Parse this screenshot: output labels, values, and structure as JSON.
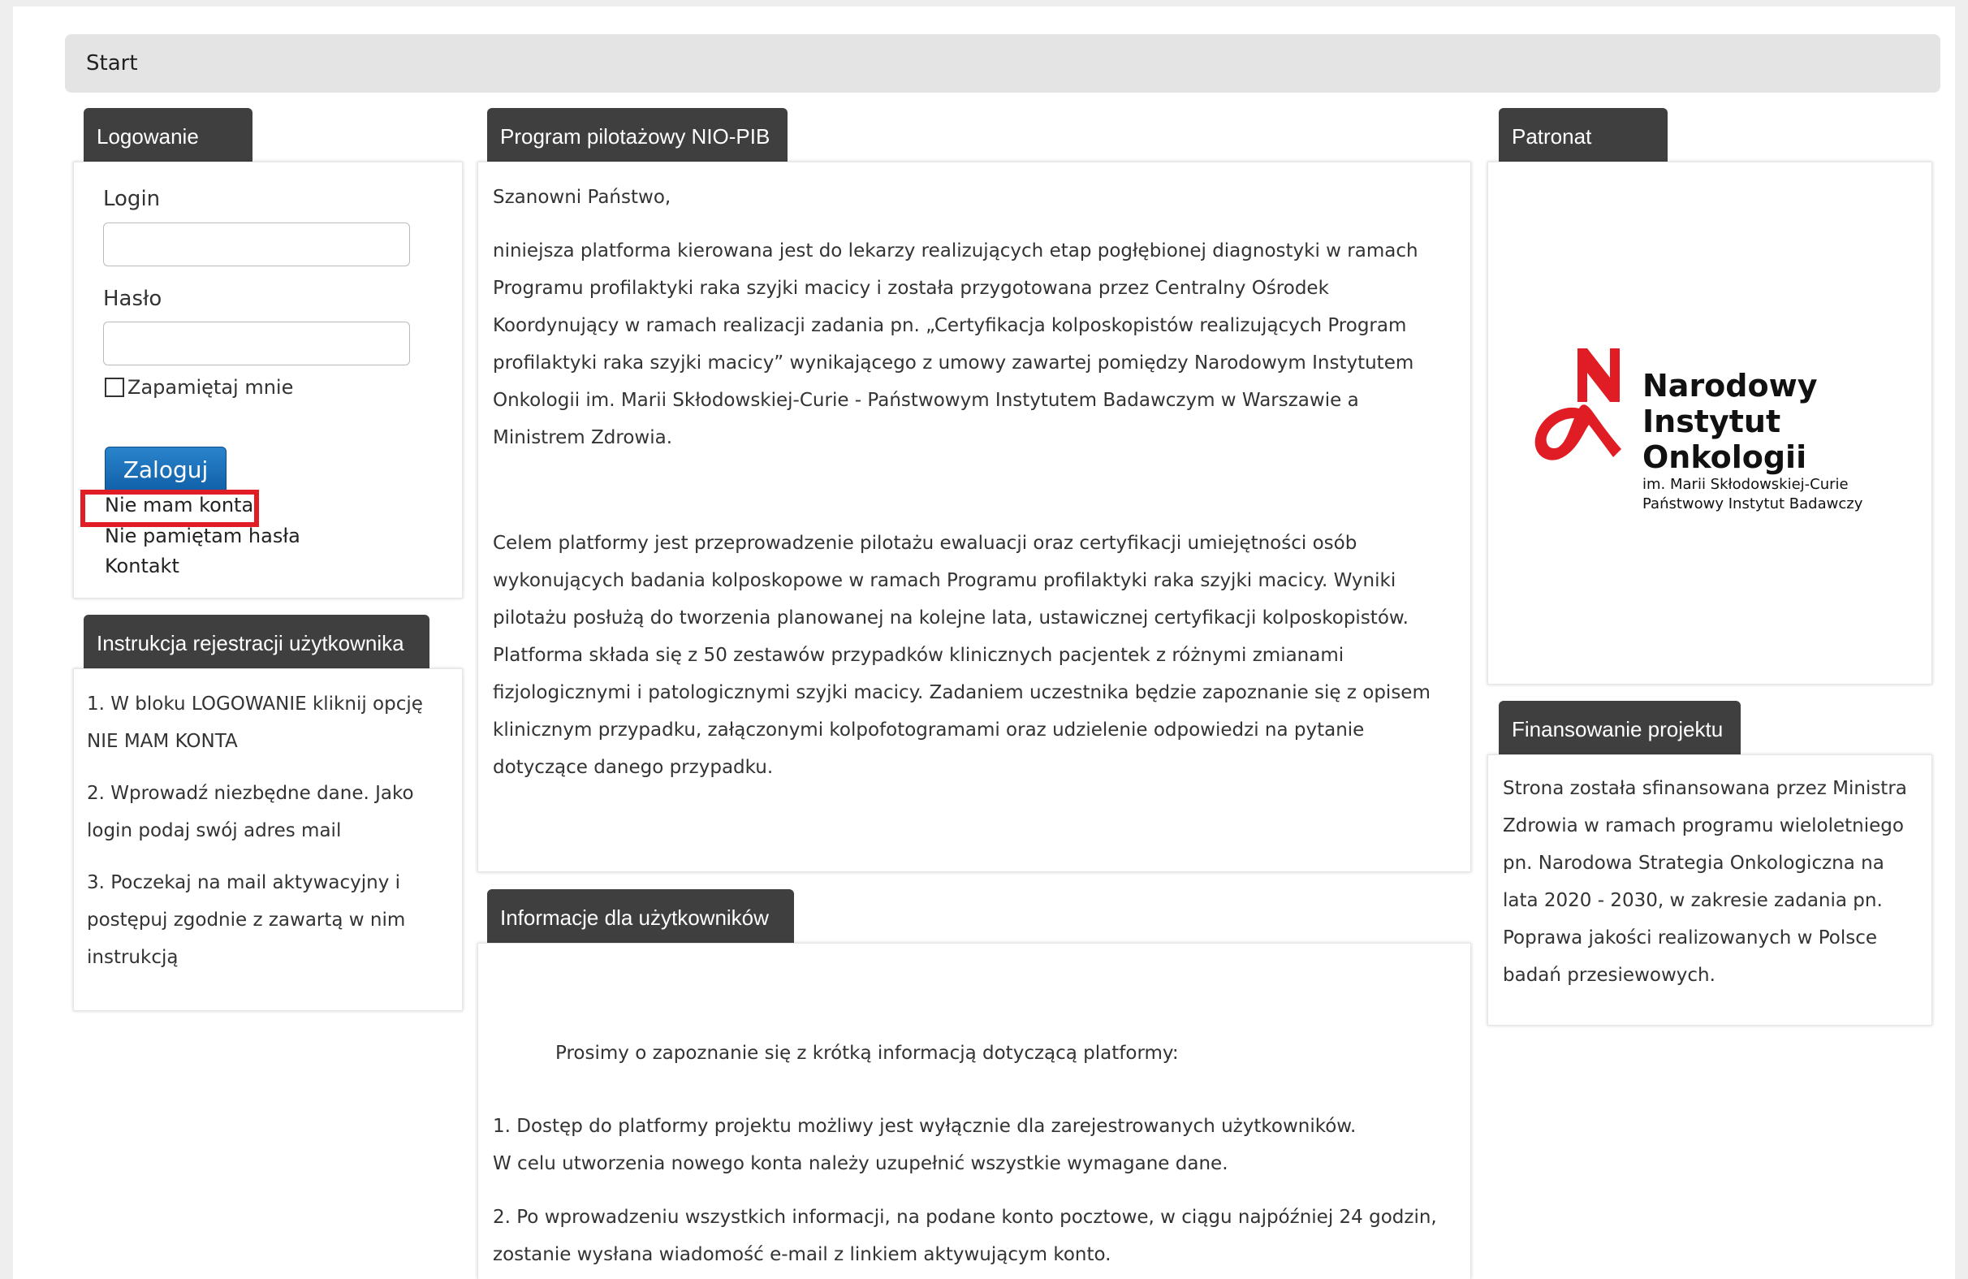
{
  "breadcrumb": {
    "label": "Start"
  },
  "login_panel": {
    "header": "Logowanie",
    "login_label": "Login",
    "password_label": "Hasło",
    "remember_label": "Zapamiętaj mnie",
    "submit_label": "Zaloguj",
    "no_account_link": "Nie mam konta",
    "forgot_password_link": "Nie pamiętam hasła",
    "contact_link": "Kontakt",
    "highlight_color": "#e01c24"
  },
  "instructions_panel": {
    "header": "Instrukcja rejestracji użytkownika",
    "steps": [
      "1. W bloku LOGOWANIE kliknij opcję NIE MAM KONTA",
      "2. Wprowadź niezbędne dane. Jako login podaj swój adres mail",
      "3. Poczekaj na mail aktywacyjny i postępuj zgodnie z zawartą w nim instrukcją"
    ]
  },
  "program_panel": {
    "header": "Program pilotażowy NIO-PIB",
    "greeting": "Szanowni Państwo,",
    "para1": "niniejsza platforma kierowana jest do lekarzy realizujących etap pogłębionej diagnostyki w ramach Programu profilaktyki raka szyjki macicy i została przygotowana przez Centralny Ośrodek Koordynujący w ramach realizacji zadania pn. „Certyfikacja kolposkopistów realizujących Program profilaktyki raka szyjki macicy” wynikającego z umowy zawartej pomiędzy Narodowym Instytutem Onkologii im. Marii Skłodowskiej-Curie - Państwowym Instytutem Badawczym w Warszawie a Ministrem Zdrowia.",
    "para2": "Celem platformy jest przeprowadzenie pilotażu ewaluacji oraz certyfikacji umiejętności osób wykonujących badania kolposkopowe w ramach Programu profilaktyki raka szyjki macicy. Wyniki pilotażu posłużą do tworzenia planowanej na kolejne lata, ustawicznej certyfikacji kolposkopistów. Platforma składa się z 50 zestawów przypadków klinicznych pacjentek z różnymi zmianami fizjologicznymi i patologicznymi szyjki macicy. Zadaniem uczestnika będzie zapoznanie się z opisem klinicznym przypadku, załączonymi kolpofotogramami oraz udzielenie odpowiedzi na pytanie dotyczące danego przypadku."
  },
  "info_panel": {
    "header": "Informacje dla użytkowników",
    "intro": "Prosimy o zapoznanie się z krótką informacją dotyczącą platformy:",
    "item1_line1": "1.   Dostęp do platformy projektu możliwy jest wyłącznie dla zarejestrowanych użytkowników.",
    "item1_line2": "W celu utworzenia nowego konta należy uzupełnić wszystkie wymagane dane.",
    "item2_line1": "2.   Po wprowadzeniu wszystkich informacji, na podane konto pocztowe, w ciągu najpóźniej 24 godzin,",
    "item2_line2": "zostanie wysłana wiadomość e-mail z linkiem aktywującym konto."
  },
  "patronat_panel": {
    "header": "Patronat",
    "logo": {
      "line1": "Narodowy",
      "line2": "Instytut",
      "line3": "Onkologii",
      "sub1": "im. Marii Skłodowskiej-Curie",
      "sub2": "Państwowy Instytut Badawczy",
      "color": "#e01c24"
    }
  },
  "funding_panel": {
    "header": "Finansowanie projektu",
    "text": "Strona została sfinansowana przez Ministra Zdrowia w ramach programu wieloletniego pn. Narodowa Strategia Onkologiczna na lata 2020 - 2030, w zakresie zadania pn. Poprawa jakości realizowanych w Polsce badań przesiewowych."
  }
}
